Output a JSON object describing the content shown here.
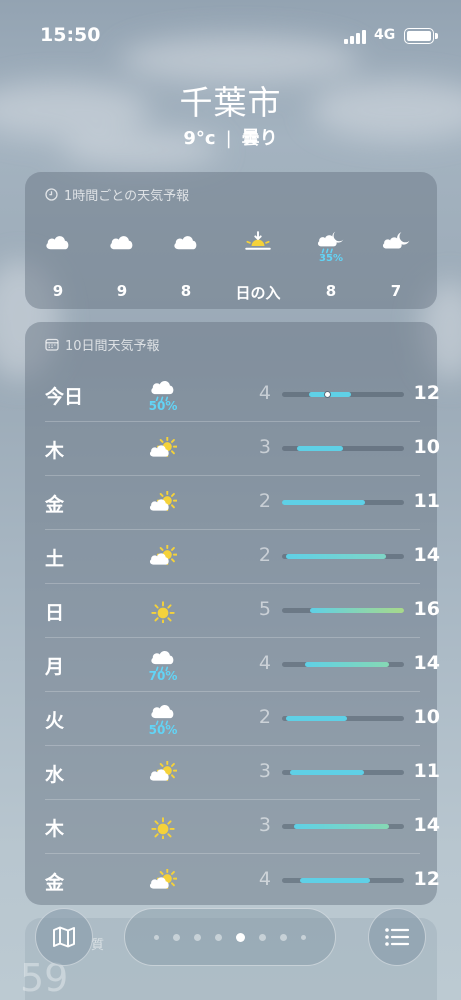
{
  "status_bar": {
    "time": "15:50",
    "network": "4G"
  },
  "location": {
    "city": "千葉市",
    "temperature": "9°c",
    "separator": "|",
    "condition": "曇り"
  },
  "hourly": {
    "title": "1時間ごとの天気予報",
    "items": [
      {
        "label": "9",
        "icon": "cloud-icon",
        "precip": ""
      },
      {
        "label": "9",
        "icon": "cloud-icon",
        "precip": ""
      },
      {
        "label": "8",
        "icon": "cloud-icon",
        "precip": ""
      },
      {
        "label": "日の入",
        "icon": "sunset-icon",
        "precip": ""
      },
      {
        "label": "8",
        "icon": "moon-rain-icon",
        "precip": "35%"
      },
      {
        "label": "7",
        "icon": "moon-cloud-icon",
        "precip": ""
      }
    ]
  },
  "daily": {
    "title": "10日間天気予報",
    "range": [
      1,
      17
    ],
    "rows": [
      {
        "day": "今日",
        "icon": "rain-icon",
        "precip": "50%",
        "low": "4",
        "high": "12",
        "low_value": 4.5,
        "high_value": 10,
        "current": 7,
        "colors": [
          "#5fd0e6",
          "#5fd0e6"
        ]
      },
      {
        "day": "木",
        "icon": "partly-sunny-icon",
        "precip": "",
        "low": "3",
        "high": "10",
        "low_value": 3,
        "high_value": 9,
        "colors": [
          "#5fd0e6",
          "#5fd0e6"
        ]
      },
      {
        "day": "金",
        "icon": "partly-sunny-icon",
        "precip": "",
        "low": "2",
        "high": "11",
        "low_value": 1,
        "high_value": 11.9,
        "colors": [
          "#5fd0e6",
          "#5fd0e6"
        ]
      },
      {
        "day": "土",
        "icon": "partly-sunny-icon",
        "precip": "",
        "low": "2",
        "high": "14",
        "low_value": 1.5,
        "high_value": 14.7,
        "colors": [
          "#5fd0e6",
          "#7fd5c6"
        ]
      },
      {
        "day": "日",
        "icon": "sun-icon",
        "precip": "",
        "low": "5",
        "high": "16",
        "low_value": 4.7,
        "high_value": 17,
        "colors": [
          "#5fd0e6",
          "#a8d98a"
        ]
      },
      {
        "day": "月",
        "icon": "rain-icon",
        "precip": "70%",
        "low": "4",
        "high": "14",
        "low_value": 4,
        "high_value": 15,
        "colors": [
          "#5fd0e6",
          "#86d8b4"
        ]
      },
      {
        "day": "火",
        "icon": "rain-icon",
        "precip": "50%",
        "low": "2",
        "high": "10",
        "low_value": 1.5,
        "high_value": 9.5,
        "colors": [
          "#5fd0e6",
          "#5fd0e6"
        ]
      },
      {
        "day": "水",
        "icon": "partly-sunny-icon",
        "precip": "",
        "low": "3",
        "high": "11",
        "low_value": 2,
        "high_value": 11.8,
        "colors": [
          "#5fd0e6",
          "#5fd0e6"
        ]
      },
      {
        "day": "木",
        "icon": "sun-icon",
        "precip": "",
        "low": "3",
        "high": "14",
        "low_value": 2.6,
        "high_value": 15,
        "colors": [
          "#5fd0e6",
          "#86d8b4"
        ]
      },
      {
        "day": "金",
        "icon": "partly-sunny-icon",
        "precip": "",
        "low": "4",
        "high": "12",
        "low_value": 3.4,
        "high_value": 12.5,
        "colors": [
          "#5fd0e6",
          "#5fd0e6"
        ]
      }
    ]
  },
  "air_quality_peek": {
    "title_fragment": "質",
    "value": "59"
  },
  "bottom_bar": {
    "page_count": 8,
    "active_page": 5,
    "map_icon": "map-icon",
    "list_icon": "list-icon"
  },
  "accent_colors": {
    "precip": "#62d4f6",
    "sun": "#f5d23a"
  }
}
